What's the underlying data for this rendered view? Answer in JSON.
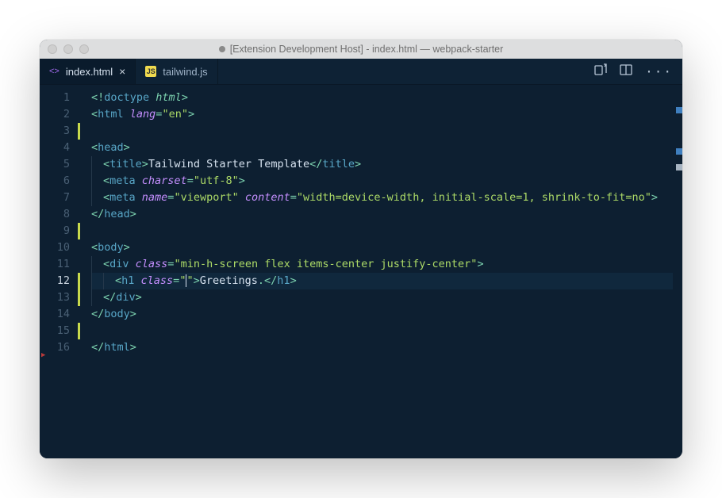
{
  "window": {
    "title": "[Extension Development Host] - index.html — webpack-starter"
  },
  "tabs": [
    {
      "label": "index.html",
      "type": "html",
      "active": true,
      "dirty": false
    },
    {
      "label": "tailwind.js",
      "type": "js",
      "active": false,
      "dirty": false
    }
  ],
  "editor": {
    "current_line": 12,
    "lines": [
      {
        "n": 1,
        "mod": false,
        "tokens": [
          [
            "p",
            "<!"
          ],
          [
            "tg",
            "doctype "
          ],
          [
            "dt",
            "html"
          ],
          [
            "p",
            ">"
          ]
        ]
      },
      {
        "n": 2,
        "mod": false,
        "tokens": [
          [
            "p",
            "<"
          ],
          [
            "tg",
            "html "
          ],
          [
            "at",
            "lang"
          ],
          [
            "eq",
            "="
          ],
          [
            "st",
            "\"en\""
          ],
          [
            "p",
            ">"
          ]
        ]
      },
      {
        "n": 3,
        "mod": true,
        "tokens": []
      },
      {
        "n": 4,
        "mod": false,
        "tokens": [
          [
            "p",
            "<"
          ],
          [
            "tg",
            "head"
          ],
          [
            "p",
            ">"
          ]
        ]
      },
      {
        "n": 5,
        "mod": false,
        "indent": 1,
        "tokens": [
          [
            "p",
            "<"
          ],
          [
            "tg",
            "title"
          ],
          [
            "p",
            ">"
          ],
          [
            "tx",
            "Tailwind Starter Template"
          ],
          [
            "p",
            "</"
          ],
          [
            "tg",
            "title"
          ],
          [
            "p",
            ">"
          ]
        ]
      },
      {
        "n": 6,
        "mod": false,
        "indent": 1,
        "tokens": [
          [
            "p",
            "<"
          ],
          [
            "tg",
            "meta "
          ],
          [
            "at",
            "charset"
          ],
          [
            "eq",
            "="
          ],
          [
            "st",
            "\"utf-8\""
          ],
          [
            "p",
            ">"
          ]
        ]
      },
      {
        "n": 7,
        "mod": false,
        "indent": 1,
        "tokens": [
          [
            "p",
            "<"
          ],
          [
            "tg",
            "meta "
          ],
          [
            "at",
            "name"
          ],
          [
            "eq",
            "="
          ],
          [
            "st",
            "\"viewport\" "
          ],
          [
            "at",
            "content"
          ],
          [
            "eq",
            "="
          ],
          [
            "st",
            "\"width=device-width, initial-scale=1, shrink-to-fit=no\""
          ],
          [
            "p",
            ">"
          ]
        ]
      },
      {
        "n": 8,
        "mod": false,
        "tokens": [
          [
            "p",
            "</"
          ],
          [
            "tg",
            "head"
          ],
          [
            "p",
            ">"
          ]
        ]
      },
      {
        "n": 9,
        "mod": true,
        "tokens": []
      },
      {
        "n": 10,
        "mod": false,
        "tokens": [
          [
            "p",
            "<"
          ],
          [
            "tg",
            "body"
          ],
          [
            "p",
            ">"
          ]
        ]
      },
      {
        "n": 11,
        "mod": false,
        "indent": 1,
        "tokens": [
          [
            "p",
            "<"
          ],
          [
            "tg",
            "div "
          ],
          [
            "at",
            "class"
          ],
          [
            "eq",
            "="
          ],
          [
            "st",
            "\"min-h-screen flex items-center justify-center\""
          ],
          [
            "p",
            ">"
          ]
        ]
      },
      {
        "n": 12,
        "mod": true,
        "indent": 2,
        "hl": true,
        "tokens": [
          [
            "p",
            "<"
          ],
          [
            "tg",
            "h1 "
          ],
          [
            "at",
            "class"
          ],
          [
            "eq",
            "="
          ],
          [
            "st",
            "\"\""
          ],
          [
            "p",
            ">"
          ],
          [
            "tx",
            "Greetings"
          ],
          [
            "p",
            "."
          ],
          [
            "p",
            "</"
          ],
          [
            "tg",
            "h1"
          ],
          [
            "p",
            ">"
          ]
        ]
      },
      {
        "n": 13,
        "mod": true,
        "indent": 1,
        "tokens": [
          [
            "p",
            "</"
          ],
          [
            "tg",
            "div"
          ],
          [
            "p",
            ">"
          ]
        ]
      },
      {
        "n": 14,
        "mod": false,
        "tokens": [
          [
            "p",
            "</"
          ],
          [
            "tg",
            "body"
          ],
          [
            "p",
            ">"
          ]
        ]
      },
      {
        "n": 15,
        "mod": true,
        "tokens": []
      },
      {
        "n": 16,
        "mod": false,
        "tokens": [
          [
            "p",
            "</"
          ],
          [
            "tg",
            "html"
          ],
          [
            "p",
            ">"
          ]
        ]
      }
    ]
  },
  "actions": {
    "compare": "compare-changes",
    "split": "split-editor",
    "more": "more-actions"
  }
}
